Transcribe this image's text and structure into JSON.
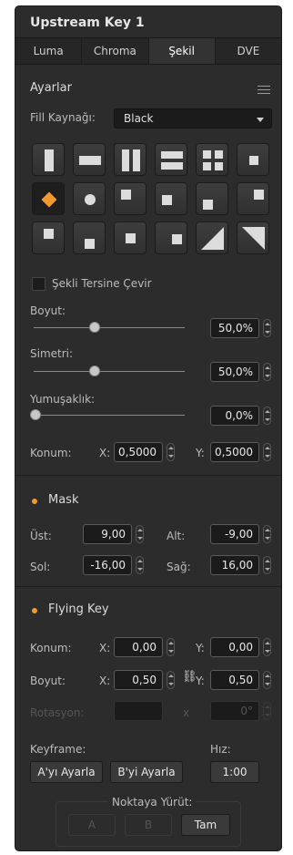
{
  "panel": {
    "title": "Upstream Key 1",
    "tabs": [
      "Luma",
      "Chroma",
      "Şekil",
      "DVE"
    ],
    "active_tab": "Şekil"
  },
  "settings": {
    "section_title": "Ayarlar",
    "menu_icon": "hamburger-menu-icon",
    "fill_source_label": "Fill Kaynağı:",
    "fill_source_value": "Black",
    "invert_label": "Şekli Tersine Çevir",
    "size_label": "Boyut:",
    "size_value": "50,0%",
    "size_fraction": 0.5,
    "symmetry_label": "Simetri:",
    "symmetry_value": "50,0%",
    "symmetry_fraction": 0.5,
    "softness_label": "Yumuşaklık:",
    "softness_value": "0,0%",
    "softness_fraction": 0.0,
    "position_label": "Konum:",
    "x_label": "X:",
    "x_value": "0,5000",
    "y_label": "Y:",
    "y_value": "0,5000"
  },
  "mask": {
    "title": "Mask",
    "top_label": "Üst:",
    "top_value": "9,00",
    "bottom_label": "Alt:",
    "bottom_value": "-9,00",
    "left_label": "Sol:",
    "left_value": "-16,00",
    "right_label": "Sağ:",
    "right_value": "16,00"
  },
  "flying_key": {
    "title": "Flying Key",
    "position_label": "Konum:",
    "pos_x_label": "X:",
    "pos_x_value": "0,00",
    "pos_y_label": "Y:",
    "pos_y_value": "0,00",
    "size_label": "Boyut:",
    "size_x_label": "X:",
    "size_x_value": "0,50",
    "size_y_label": "Y:",
    "size_y_value": "0,50",
    "rotation_label": "Rotasyon:",
    "rotation_x": "x",
    "rotation_value": "0°",
    "keyframe_label": "Keyframe:",
    "set_a": "A'yı Ayarla",
    "set_b": "B'yi Ayarla",
    "rate_label": "Hız:",
    "rate_value": "1:00",
    "run_to_label": "Noktaya Yürüt:",
    "run_a": "A",
    "run_b": "B",
    "run_full": "Tam"
  },
  "colors": {
    "accent": "#f29a2e",
    "panel_bg": "#2c2c2c"
  }
}
